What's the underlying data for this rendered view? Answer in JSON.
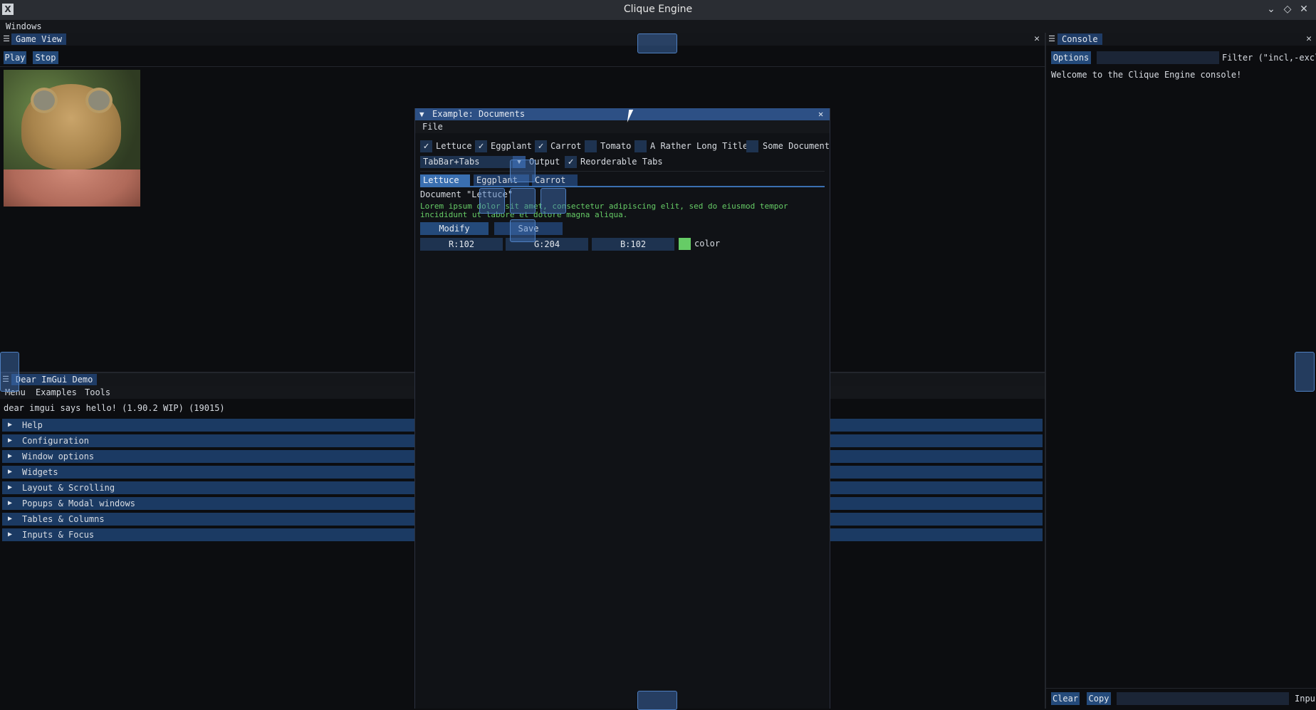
{
  "app": {
    "title": "Clique Engine",
    "menu": "Windows"
  },
  "game_view": {
    "tab": "Game View",
    "play": "Play",
    "stop": "Stop",
    "image_alt": "frog-image"
  },
  "console": {
    "tab": "Console",
    "options": "Options",
    "filter_label": "Filter (\"incl,-excl",
    "welcome": "Welcome to the Clique Engine console!",
    "clear": "Clear",
    "copy": "Copy",
    "input_label": "Inpu"
  },
  "demo": {
    "tab": "Dear ImGui Demo",
    "menus": [
      "Menu",
      "Examples",
      "Tools"
    ],
    "hello": "dear imgui says hello! (1.90.2 WIP) (19015)",
    "sections": [
      "Help",
      "Configuration",
      "Window options",
      "Widgets",
      "Layout & Scrolling",
      "Popups & Modal windows",
      "Tables & Columns",
      "Inputs & Focus"
    ]
  },
  "documents": {
    "title": "Example: Documents",
    "menu": "File",
    "checks": [
      {
        "label": "Lettuce",
        "checked": true
      },
      {
        "label": "Eggplant",
        "checked": true
      },
      {
        "label": "Carrot",
        "checked": true
      },
      {
        "label": "Tomato",
        "checked": false
      },
      {
        "label": "A Rather Long Title",
        "checked": false
      },
      {
        "label": "Some Document",
        "checked": false
      }
    ],
    "combo_value": "TabBar+Tabs",
    "combo_label": "Output",
    "reorder_label": "Reorderable Tabs",
    "tabs": [
      "Lettuce",
      "Eggplant",
      "Carrot"
    ],
    "doc_title": "Document \"Lettuce\"",
    "lorem1": "Lorem ipsum dolor sit amet, consectetur adipiscing elit, sed do eiusmod tempor",
    "lorem2": "incididunt ut labore et dolore magna aliqua.",
    "modify": "Modify",
    "save": "Save",
    "r": "R:102",
    "g": "G:204",
    "b": "B:102",
    "color_label": "color",
    "color_hex": "#66cc66",
    "text_color": "#66cc66"
  }
}
